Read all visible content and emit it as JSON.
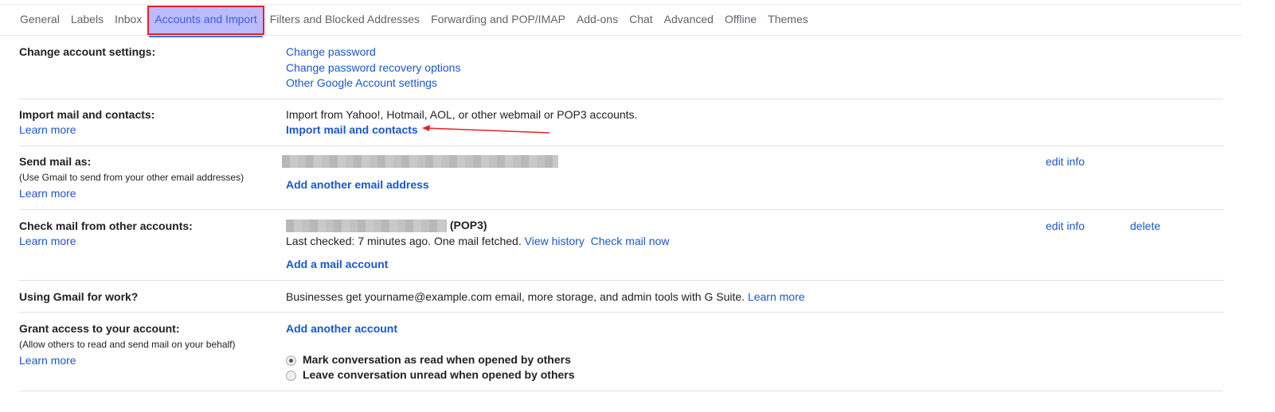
{
  "tabs": [
    "General",
    "Labels",
    "Inbox",
    "Accounts and Import",
    "Filters and Blocked Addresses",
    "Forwarding and POP/IMAP",
    "Add-ons",
    "Chat",
    "Advanced",
    "Offline",
    "Themes"
  ],
  "active_tab": "Accounts and Import",
  "learn_more": "Learn more",
  "change_account": {
    "label": "Change account settings:",
    "links": [
      "Change password",
      "Change password recovery options",
      "Other Google Account settings"
    ]
  },
  "import": {
    "label": "Import mail and contacts:",
    "text": "Import from Yahoo!, Hotmail, AOL, or other webmail or POP3 accounts.",
    "action": "Import mail and contacts"
  },
  "send_as": {
    "label": "Send mail as:",
    "sub": "(Use Gmail to send from your other email addresses)",
    "edit": "edit info",
    "add": "Add another email address"
  },
  "check_mail": {
    "label": "Check mail from other accounts:",
    "suffix": "(POP3)",
    "last_checked": "Last checked: 7 minutes ago. One mail fetched.",
    "view_history": "View history",
    "check_now": "Check mail now",
    "edit": "edit info",
    "delete": "delete",
    "add": "Add a mail account"
  },
  "work": {
    "label": "Using Gmail for work?",
    "text": "Businesses get yourname@example.com email, more storage, and admin tools with G Suite.",
    "link": "Learn more"
  },
  "grant": {
    "label": "Grant access to your account:",
    "sub": "(Allow others to read and send mail on your behalf)",
    "add": "Add another account",
    "options": [
      "Mark conversation as read when opened by others",
      "Leave conversation unread when opened by others"
    ],
    "selected": 0
  },
  "colors": {
    "link": "#1a57cd",
    "active_tab_bg": "#bbbcfe",
    "highlight_border": "#e5202b",
    "arrow": "#e5202b"
  }
}
